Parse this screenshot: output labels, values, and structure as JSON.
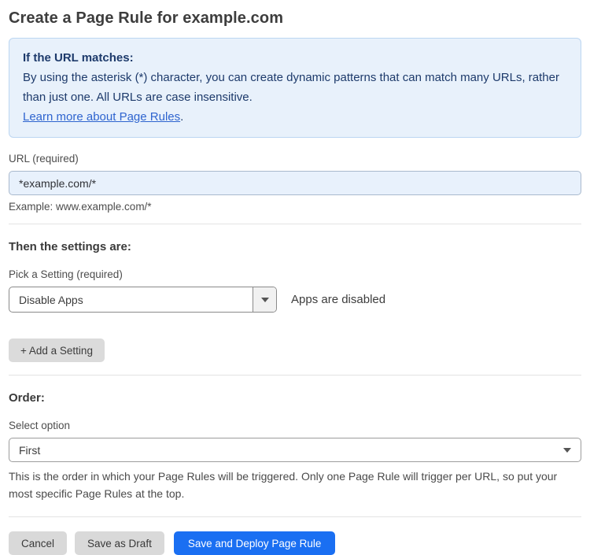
{
  "page": {
    "title": "Create a Page Rule for example.com"
  },
  "info_box": {
    "heading": "If the URL matches:",
    "body": "By using the asterisk (*) character, you can create dynamic patterns that can match many URLs, rather than just one. All URLs are case insensitive.",
    "link_label": "Learn more about Page Rules",
    "link_suffix": "."
  },
  "url_field": {
    "label": "URL (required)",
    "value": "*example.com/*",
    "example": "Example: www.example.com/*"
  },
  "settings": {
    "heading": "Then the settings are:",
    "picker_label": "Pick a Setting (required)",
    "picker_value": "Disable Apps",
    "status_text": "Apps are disabled",
    "add_button_label": "+ Add a Setting"
  },
  "order": {
    "heading": "Order:",
    "select_label": "Select option",
    "select_value": "First",
    "help_text": "This is the order in which your Page Rules will be triggered. Only one Page Rule will trigger per URL, so put your most specific Page Rules at the top."
  },
  "actions": {
    "cancel_label": "Cancel",
    "save_draft_label": "Save as Draft",
    "save_deploy_label": "Save and Deploy Page Rule"
  },
  "colors": {
    "primary_button": "#1a6ff2",
    "info_box_background": "#e8f1fb",
    "info_box_border": "#bcd6f2",
    "info_box_text": "#1d3a6b",
    "link": "#2e64cf",
    "url_input_background": "#e8f1fc",
    "gray_button": "#d9d9d9"
  }
}
